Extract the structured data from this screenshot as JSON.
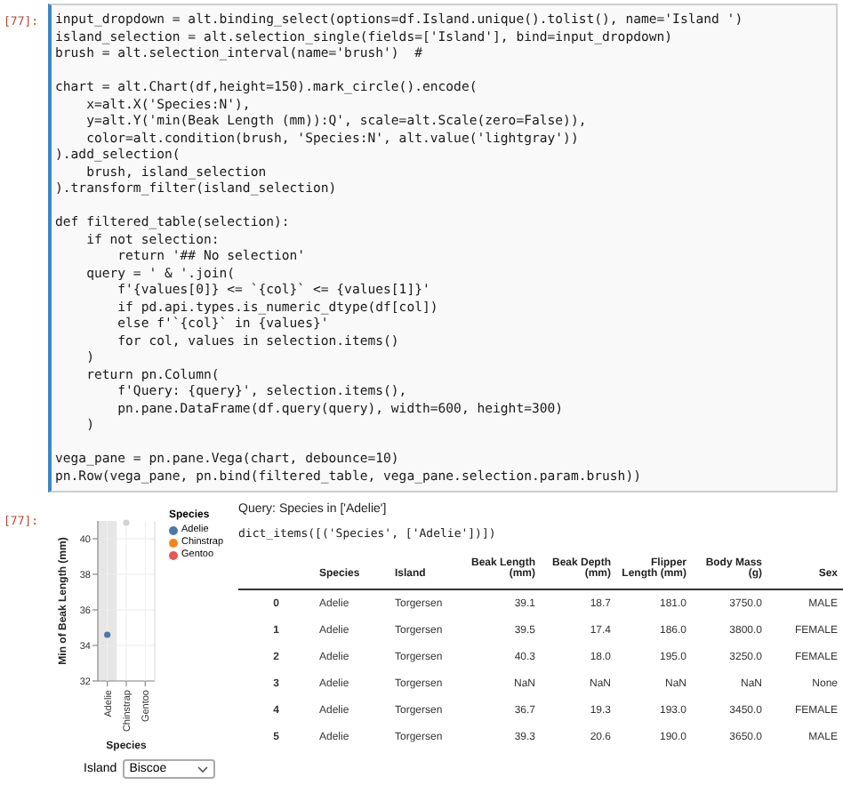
{
  "code_cell": {
    "prompt": "[77]:",
    "blocks": [
      [
        "input_dropdown = alt.binding_select(options=df.Island.unique().tolist(), name='Island ')",
        "island_selection = alt.selection_single(fields=['Island'], bind=input_dropdown)",
        "brush = alt.selection_interval(name='brush')  #"
      ],
      [
        "chart = alt.Chart(df,height=150).mark_circle().encode(",
        "    x=alt.X('Species:N'),",
        "    y=alt.Y('min(Beak Length (mm)):Q', scale=alt.Scale(zero=False)),",
        "    color=alt.condition(brush, 'Species:N', alt.value('lightgray'))",
        ").add_selection(",
        "    brush, island_selection",
        ").transform_filter(island_selection)"
      ],
      [
        "def filtered_table(selection):",
        "    if not selection:",
        "        return '## No selection'",
        "    query = ' & '.join(",
        "        f'{values[0]} <= `{col}` <= {values[1]}'",
        "        if pd.api.types.is_numeric_dtype(df[col])",
        "        else f'`{col}` in {values}'",
        "        for col, values in selection.items()",
        "    )",
        "    return pn.Column(",
        "        f'Query: {query}', selection.items(),",
        "        pn.pane.DataFrame(df.query(query), width=600, height=300)",
        "    )"
      ],
      [
        "vega_pane = pn.pane.Vega(chart, debounce=10)",
        "pn.Row(vega_pane, pn.bind(filtered_table, vega_pane.selection.param.brush))"
      ]
    ]
  },
  "output": {
    "prompt": "[77]:",
    "chart": {
      "legend": {
        "title": "Species",
        "items": [
          {
            "label": "Adelie",
            "color": "#4c78a8"
          },
          {
            "label": "Chinstrap",
            "color": "#f58518"
          },
          {
            "label": "Gentoo",
            "color": "#e45756"
          }
        ]
      },
      "chart_data": {
        "type": "scatter",
        "xlabel": "Species",
        "ylabel": "Min of Beak Length (mm)",
        "categories": [
          "Adelie",
          "Chinstrap",
          "Gentoo"
        ],
        "values": [
          34.6,
          40.9,
          null
        ],
        "ylim": [
          32,
          41
        ],
        "yticks": [
          32,
          34,
          36,
          38,
          40
        ],
        "grid": true,
        "bands": [
          {
            "axis": "x",
            "from": "Adelie",
            "to": "Adelie"
          }
        ]
      }
    },
    "dropdown": {
      "label": "Island",
      "value": "Biscoe"
    },
    "query_text": "Query: Species in ['Adelie']",
    "dict_text": "dict_items([('Species', ['Adelie'])])",
    "table": {
      "columns": [
        "",
        "Species",
        "Island",
        "Beak Length (mm)",
        "Beak Depth (mm)",
        "Flipper Length (mm)",
        "Body Mass (g)",
        "Sex"
      ],
      "rows": [
        [
          "0",
          "Adelie",
          "Torgersen",
          "39.1",
          "18.7",
          "181.0",
          "3750.0",
          "MALE"
        ],
        [
          "1",
          "Adelie",
          "Torgersen",
          "39.5",
          "17.4",
          "186.0",
          "3800.0",
          "FEMALE"
        ],
        [
          "2",
          "Adelie",
          "Torgersen",
          "40.3",
          "18.0",
          "195.0",
          "3250.0",
          "FEMALE"
        ],
        [
          "3",
          "Adelie",
          "Torgersen",
          "NaN",
          "NaN",
          "NaN",
          "NaN",
          "None"
        ],
        [
          "4",
          "Adelie",
          "Torgersen",
          "36.7",
          "19.3",
          "193.0",
          "3450.0",
          "FEMALE"
        ],
        [
          "5",
          "Adelie",
          "Torgersen",
          "39.3",
          "20.6",
          "190.0",
          "3650.0",
          "MALE"
        ]
      ]
    }
  }
}
